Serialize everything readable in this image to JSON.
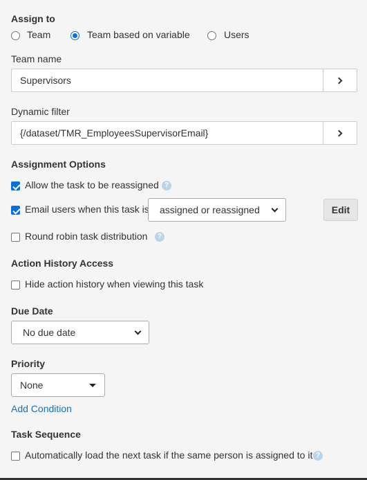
{
  "assign_to": {
    "title": "Assign to",
    "options": [
      {
        "label": "Team",
        "selected": false
      },
      {
        "label": "Team based on variable",
        "selected": true
      },
      {
        "label": "Users",
        "selected": false
      }
    ]
  },
  "team_name": {
    "label": "Team name",
    "value": "Supervisors",
    "button_icon": "chevron-right-icon"
  },
  "dynamic_filter": {
    "label": "Dynamic filter",
    "value": "{/dataset/TMR_EmployeesSupervisorEmail}",
    "button_icon": "chevron-right-icon"
  },
  "assignment_options": {
    "title": "Assignment Options",
    "allow_reassign": {
      "label": "Allow the task to be reassigned",
      "checked": true
    },
    "email_users": {
      "label": "Email users when this task is",
      "checked": true,
      "select_value": "assigned or reassigned",
      "edit_label": "Edit"
    },
    "round_robin": {
      "label": "Round robin task distribution",
      "checked": false
    }
  },
  "action_history": {
    "title": "Action History Access",
    "hide_history": {
      "label": "Hide action history when viewing this task",
      "checked": false
    }
  },
  "due_date": {
    "title": "Due Date",
    "select_value": "No due date"
  },
  "priority": {
    "title": "Priority",
    "select_value": "None",
    "add_condition_label": "Add Condition"
  },
  "task_sequence": {
    "title": "Task Sequence",
    "auto_load": {
      "label": "Automatically load the next task if the same person is assigned to it",
      "checked": false
    }
  },
  "colors": {
    "accent": "#0b6fd3",
    "link": "#1a6fb5",
    "background": "#f5f5f5"
  }
}
